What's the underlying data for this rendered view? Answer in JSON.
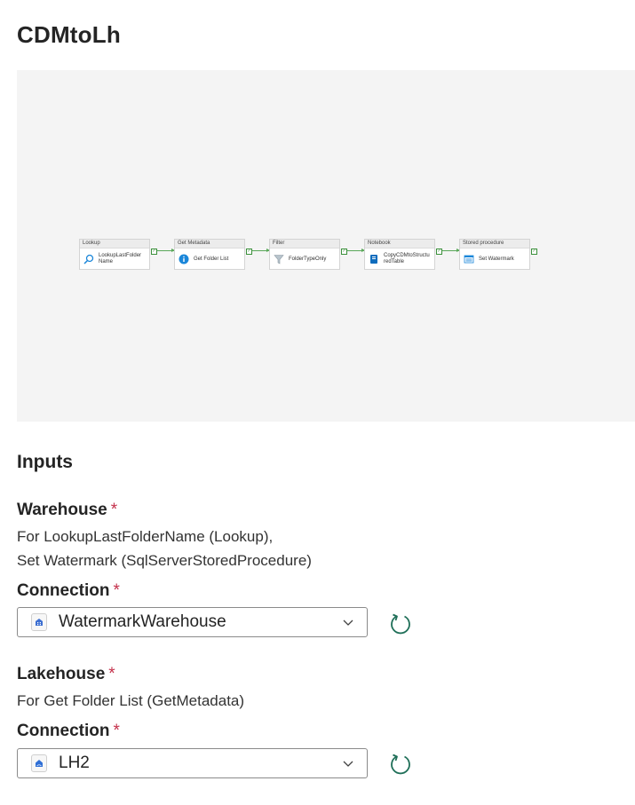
{
  "page": {
    "title": "CDMtoLh"
  },
  "pipeline": {
    "activities": [
      {
        "type": "Lookup",
        "name": "LookupLastFolderName",
        "icon": "lookup-icon"
      },
      {
        "type": "Get Metadata",
        "name": "Get Folder List",
        "icon": "info-icon"
      },
      {
        "type": "Filter",
        "name": "FolderTypeOnly",
        "icon": "filter-icon"
      },
      {
        "type": "Notebook",
        "name": "CopyCDMtoStructuredTable",
        "icon": "notebook-icon"
      },
      {
        "type": "Stored procedure",
        "name": "Set Watermark",
        "icon": "stored-procedure-icon"
      }
    ]
  },
  "inputs": {
    "heading": "Inputs",
    "warehouse": {
      "label": "Warehouse",
      "required_mark": "*",
      "description_line1": "For LookupLastFolderName (Lookup),",
      "description_line2": "Set Watermark (SqlServerStoredProcedure)",
      "connection_label": "Connection",
      "connection_value": "WatermarkWarehouse",
      "connection_icon": "warehouse-icon"
    },
    "lakehouse": {
      "label": "Lakehouse",
      "required_mark": "*",
      "description_line1": "For Get Folder List (GetMetadata)",
      "connection_label": "Connection",
      "connection_value": "LH2",
      "connection_icon": "lakehouse-icon"
    }
  },
  "colors": {
    "accent": "#0f6cbd",
    "required": "#c4314b",
    "success": "#5aa85a",
    "refresh": "#1f6f58"
  }
}
